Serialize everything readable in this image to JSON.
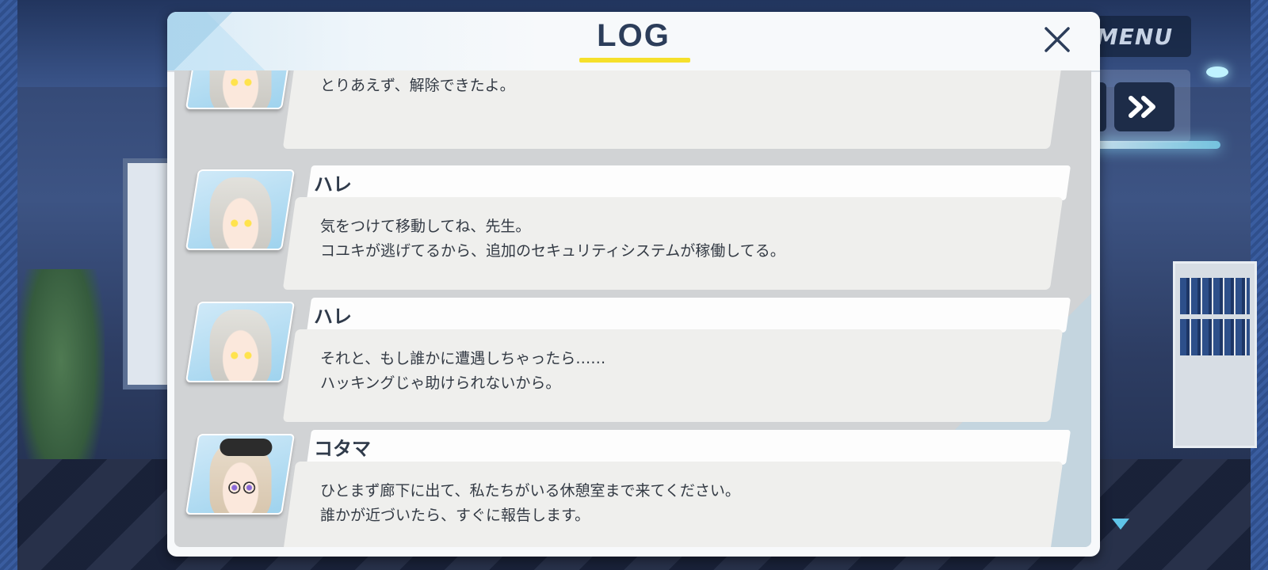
{
  "log": {
    "title": "LOG",
    "entries": [
      {
        "speaker": "",
        "portrait": "hare-portrait",
        "lines": [
          "とりあえず、解除できたよ。",
          ""
        ]
      },
      {
        "speaker": "ハレ",
        "portrait": "hare-portrait",
        "lines": [
          "気をつけて移動してね、先生。",
          "コユキが逃げてるから、追加のセキュリティシステムが稼働してる。"
        ]
      },
      {
        "speaker": "ハレ",
        "portrait": "hare-portrait",
        "lines": [
          "それと、もし誰かに遭遇しちゃったら……",
          "ハッキングじゃ助けられないから。"
        ]
      },
      {
        "speaker": "コタマ",
        "portrait": "kotama-portrait",
        "lines": [
          "ひとまず廊下に出て、私たちがいる休憩室まで来てください。",
          "誰かが近づいたら、すぐに報告します。"
        ]
      }
    ]
  },
  "controls": {
    "menu_label": "MENU",
    "fast_forward_icon": "fast-forward-icon",
    "close_icon": "close-icon",
    "next_icon": "next-arrow-icon"
  },
  "colors": {
    "title_underline": "#f5e02b",
    "title_text": "#2c3d5a",
    "panel_bg": "#f7f9fb"
  }
}
